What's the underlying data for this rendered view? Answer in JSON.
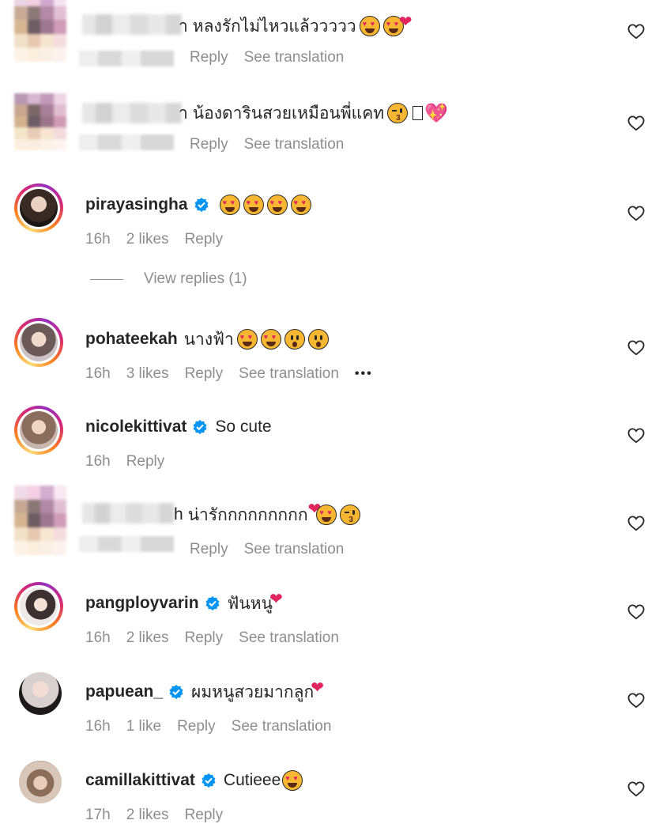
{
  "comments": [
    {
      "id": 1,
      "blurred": true,
      "name_suffix": "า",
      "text": "หลงรักไม่ไหวแล้ววววว",
      "emojis": [
        "heart-eyes",
        "heart-eyes-heart"
      ],
      "actions": {
        "reply": "Reply",
        "translation": "See translation"
      }
    },
    {
      "id": 2,
      "blurred": true,
      "name_suffix": "า",
      "text": "น้องดารินสวยเหมือนพี่แคท",
      "emojis": [
        "kiss",
        "box",
        "sparkle-heart"
      ],
      "actions": {
        "reply": "Reply",
        "translation": "See translation"
      }
    },
    {
      "id": 3,
      "blurred": false,
      "username": "pirayasingha",
      "verified": true,
      "text": "",
      "emojis": [
        "heart-eyes",
        "heart-eyes",
        "heart-eyes",
        "heart-eyes"
      ],
      "time": "16h",
      "likes": "2 likes",
      "reply": "Reply",
      "view_replies": "View replies (1)"
    },
    {
      "id": 4,
      "blurred": false,
      "username": "pohateekah",
      "verified": false,
      "text": "นางฟ้า",
      "emojis": [
        "heart-eyes",
        "heart-eyes",
        "wow",
        "wow"
      ],
      "time": "16h",
      "likes": "3 likes",
      "reply": "Reply",
      "translation": "See translation",
      "more": "•••"
    },
    {
      "id": 5,
      "blurred": false,
      "username": "nicolekittivat",
      "verified": true,
      "text": "So cute",
      "emojis": [],
      "time": "16h",
      "reply": "Reply"
    },
    {
      "id": 6,
      "blurred": true,
      "name_suffix": "h",
      "text": "น่ารักกกกกกกกก",
      "emojis": [
        "heart-eyes-heart",
        "kiss"
      ],
      "actions": {
        "reply": "Reply",
        "translation": "See translation"
      }
    },
    {
      "id": 7,
      "blurred": false,
      "username": "pangployvarin",
      "verified": true,
      "text": "ฟันหนู",
      "emojis": [
        "red-heart"
      ],
      "time": "16h",
      "likes": "2 likes",
      "reply": "Reply",
      "translation": "See translation"
    },
    {
      "id": 8,
      "blurred": false,
      "username": "papuean_",
      "verified": true,
      "text": "ผมหนูสวยมากลูก",
      "emojis": [
        "red-heart"
      ],
      "time": "16h",
      "likes": "1 like",
      "reply": "Reply",
      "translation": "See translation"
    },
    {
      "id": 9,
      "blurred": false,
      "username": "camillakittivat",
      "verified": true,
      "text": "Cutieee",
      "emojis": [
        "heart-eyes"
      ],
      "time": "17h",
      "likes": "2 likes",
      "reply": "Reply"
    }
  ],
  "colors": {
    "verified": "#0095f6",
    "meta": "#8e8e8e",
    "text": "#262626"
  },
  "icons": {
    "like": "heart-outline-icon",
    "verified": "verified-badge-icon",
    "more": "more-options-icon"
  }
}
